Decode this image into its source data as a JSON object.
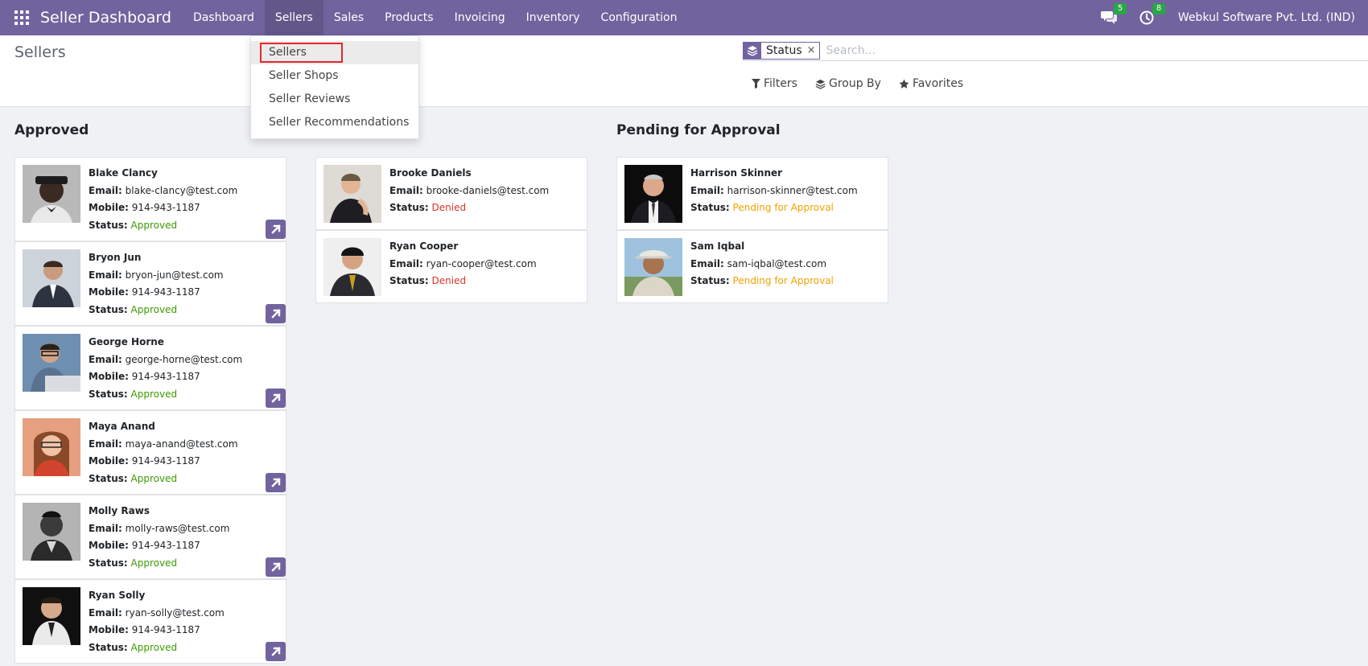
{
  "navbar": {
    "brand": "Seller Dashboard",
    "menu": [
      "Dashboard",
      "Sellers",
      "Sales",
      "Products",
      "Invoicing",
      "Inventory",
      "Configuration"
    ],
    "active_menu": "Sellers",
    "messages_count": "5",
    "activities_count": "8",
    "company": "Webkul Software Pvt. Ltd. (IND)",
    "accent_color": "#71639e"
  },
  "control_panel": {
    "breadcrumb": "Sellers",
    "search": {
      "facet_value": "Status",
      "facet_remove": "×",
      "placeholder": "Search..."
    },
    "filters_label": "Filters",
    "groupby_label": "Group By",
    "favorites_label": "Favorites"
  },
  "sellers_menu": {
    "items": [
      "Sellers",
      "Seller Shops",
      "Seller Reviews",
      "Seller Recommendations"
    ],
    "highlighted": "Sellers"
  },
  "labels": {
    "email": "Email:",
    "mobile": "Mobile:",
    "status": "Status:"
  },
  "columns": [
    {
      "title": "Approved",
      "cards": [
        {
          "name": "Blake Clancy",
          "email": "blake-clancy@test.com",
          "mobile": "914-943-1187",
          "status": "Approved"
        },
        {
          "name": "Bryon Jun",
          "email": "bryon-jun@test.com",
          "mobile": "914-943-1187",
          "status": "Approved"
        },
        {
          "name": "George Horne",
          "email": "george-horne@test.com",
          "mobile": "914-943-1187",
          "status": "Approved"
        },
        {
          "name": "Maya Anand",
          "email": "maya-anand@test.com",
          "mobile": "914-943-1187",
          "status": "Approved"
        },
        {
          "name": "Molly Raws",
          "email": "molly-raws@test.com",
          "mobile": "914-943-1187",
          "status": "Approved"
        },
        {
          "name": "Ryan Solly",
          "email": "ryan-solly@test.com",
          "mobile": "914-943-1187",
          "status": "Approved"
        }
      ]
    },
    {
      "title": "",
      "cards": [
        {
          "name": "Brooke Daniels",
          "email": "brooke-daniels@test.com",
          "status": "Denied"
        },
        {
          "name": "Ryan Cooper",
          "email": "ryan-cooper@test.com",
          "status": "Denied"
        }
      ]
    },
    {
      "title": "Pending for Approval",
      "cards": [
        {
          "name": "Harrison Skinner",
          "email": "harrison-skinner@test.com",
          "status": "Pending for Approval"
        },
        {
          "name": "Sam Iqbal",
          "email": "sam-iqbal@test.com",
          "status": "Pending for Approval"
        }
      ]
    }
  ],
  "status_colors": {
    "approved": "#3c9b00",
    "denied": "#d9342b",
    "pending": "#f0a200"
  }
}
